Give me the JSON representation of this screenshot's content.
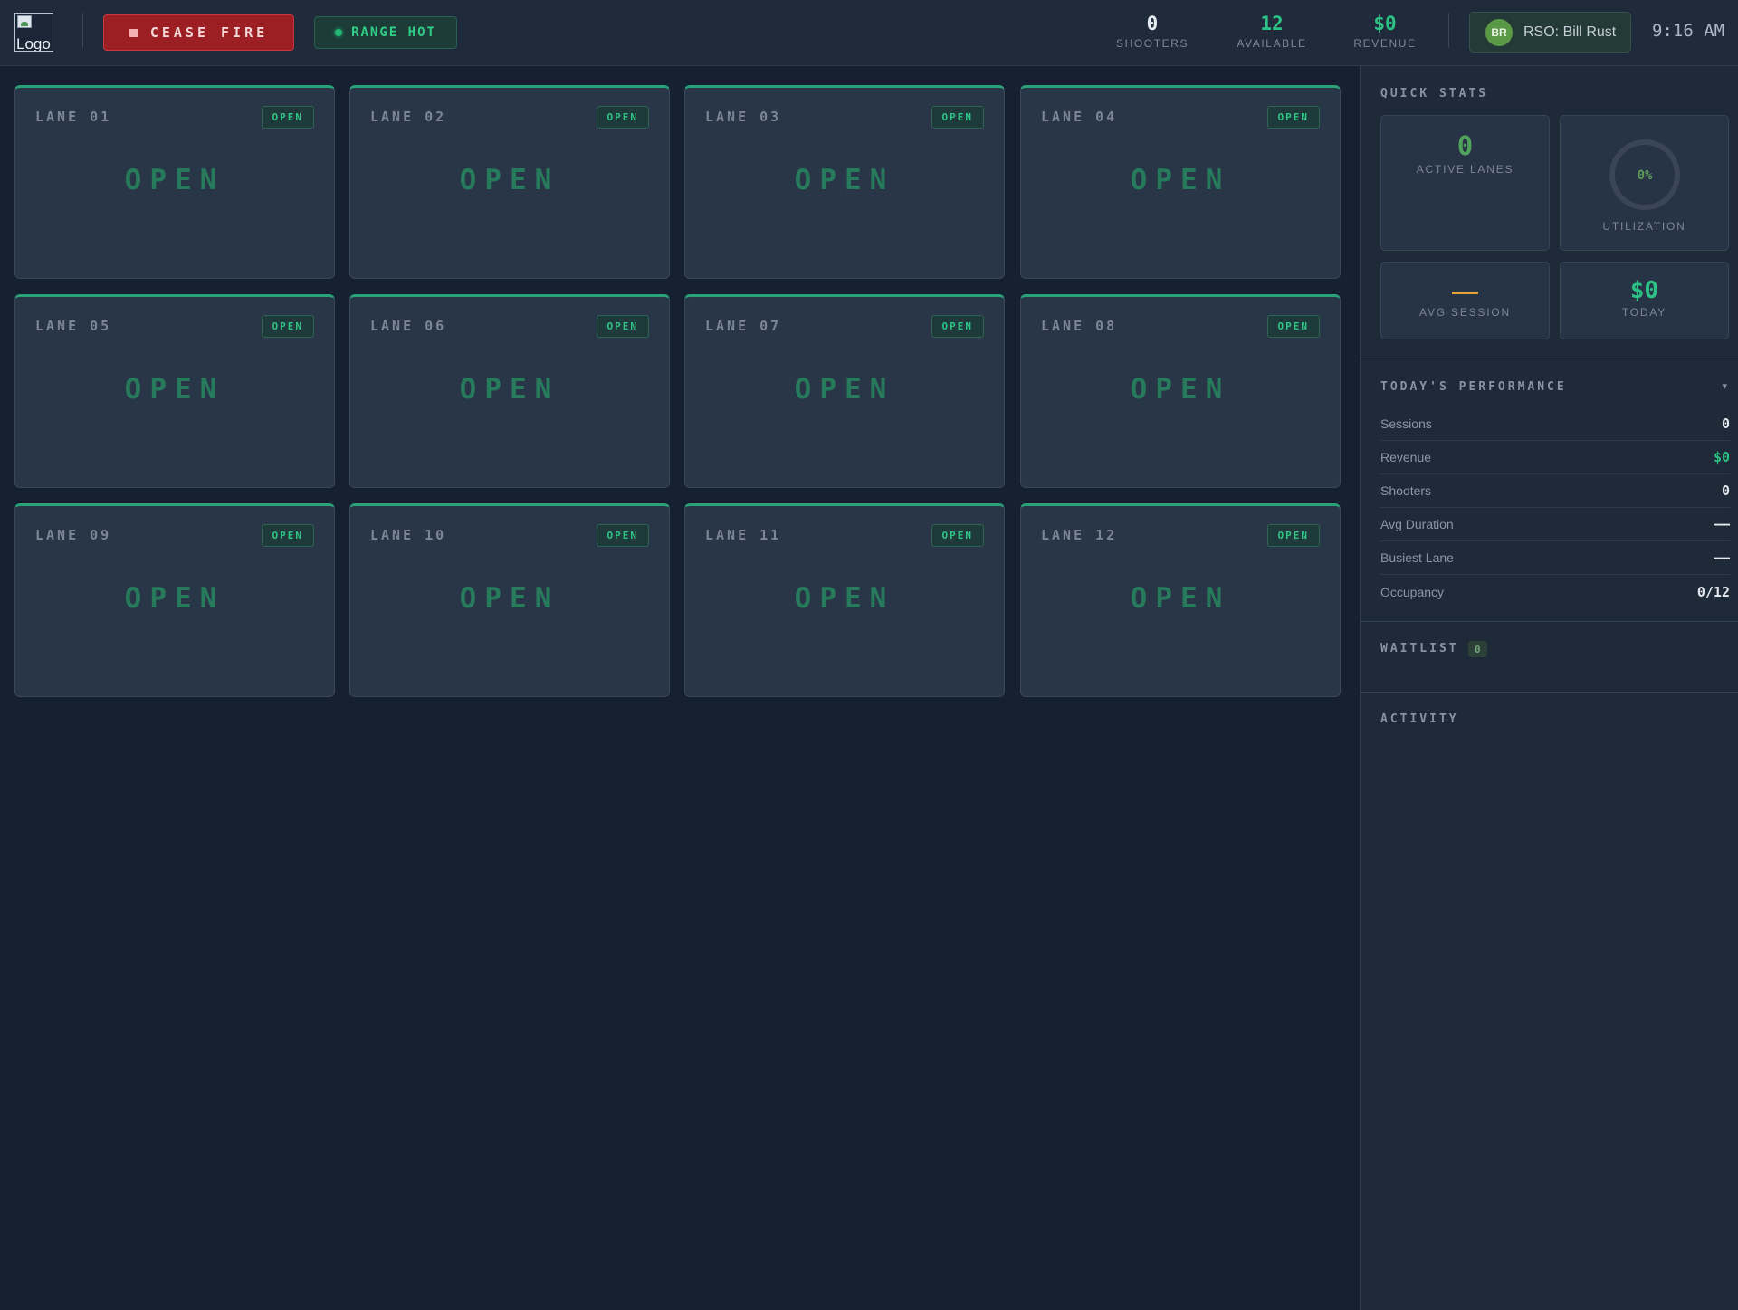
{
  "header": {
    "logo_alt": "Logo",
    "cease_fire_label": "CEASE FIRE",
    "range_status_label": "RANGE HOT",
    "metrics": [
      {
        "value": "0",
        "label": "SHOOTERS",
        "color": "#e6ebf1"
      },
      {
        "value": "12",
        "label": "AVAILABLE",
        "color": "#2dc285"
      },
      {
        "value": "$0",
        "label": "REVENUE",
        "color": "#2dc285"
      }
    ],
    "rso": {
      "initials": "BR",
      "label": "RSO: Bill Rust"
    },
    "clock": "9:16 AM"
  },
  "lanes": [
    {
      "label": "LANE 01",
      "badge": "OPEN",
      "status": "OPEN"
    },
    {
      "label": "LANE 02",
      "badge": "OPEN",
      "status": "OPEN"
    },
    {
      "label": "LANE 03",
      "badge": "OPEN",
      "status": "OPEN"
    },
    {
      "label": "LANE 04",
      "badge": "OPEN",
      "status": "OPEN"
    },
    {
      "label": "LANE 05",
      "badge": "OPEN",
      "status": "OPEN"
    },
    {
      "label": "LANE 06",
      "badge": "OPEN",
      "status": "OPEN"
    },
    {
      "label": "LANE 07",
      "badge": "OPEN",
      "status": "OPEN"
    },
    {
      "label": "LANE 08",
      "badge": "OPEN",
      "status": "OPEN"
    },
    {
      "label": "LANE 09",
      "badge": "OPEN",
      "status": "OPEN"
    },
    {
      "label": "LANE 10",
      "badge": "OPEN",
      "status": "OPEN"
    },
    {
      "label": "LANE 11",
      "badge": "OPEN",
      "status": "OPEN"
    },
    {
      "label": "LANE 12",
      "badge": "OPEN",
      "status": "OPEN"
    }
  ],
  "sidebar": {
    "quick_stats": {
      "title": "QUICK STATS",
      "active_lanes": {
        "value": "0",
        "label": "ACTIVE LANES"
      },
      "utilization": {
        "value": "0%",
        "label": "UTILIZATION",
        "fraction": 0
      },
      "avg_session": {
        "value": "——",
        "label": "AVG SESSION"
      },
      "today": {
        "value": "$0",
        "label": "TODAY"
      }
    },
    "performance": {
      "title": "TODAY'S PERFORMANCE",
      "rows": [
        {
          "key": "Sessions",
          "value": "0",
          "color": "#e4e9ef"
        },
        {
          "key": "Revenue",
          "value": "$0",
          "color": "#2dc285"
        },
        {
          "key": "Shooters",
          "value": "0",
          "color": "#e4e9ef"
        },
        {
          "key": "Avg Duration",
          "value": "——",
          "color": "#e4e9ef"
        },
        {
          "key": "Busiest Lane",
          "value": "——",
          "color": "#e4e9ef"
        },
        {
          "key": "Occupancy",
          "value": "0/12",
          "color": "#e4e9ef"
        }
      ]
    },
    "waitlist": {
      "title": "WAITLIST",
      "count": "0"
    },
    "activity": {
      "title": "ACTIVITY"
    }
  }
}
